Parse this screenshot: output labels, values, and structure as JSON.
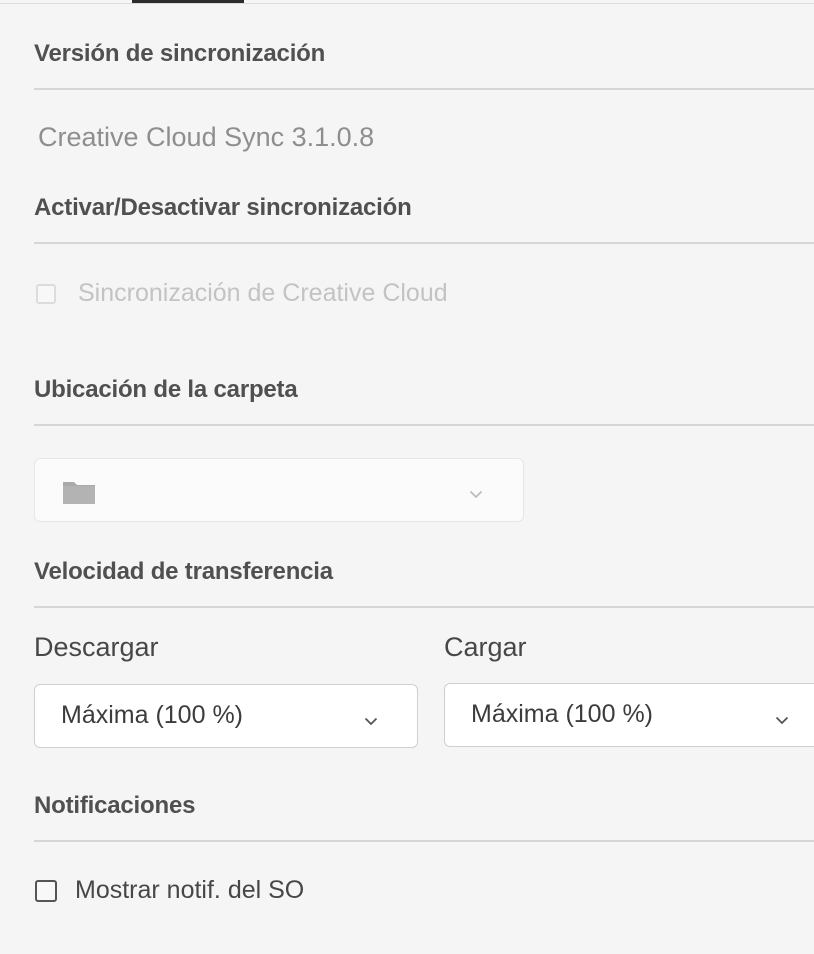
{
  "sync_version": {
    "title": "Versión de sincronización",
    "value": "Creative Cloud Sync 3.1.0.8"
  },
  "sync_toggle": {
    "title": "Activar/Desactivar sincronización",
    "checkbox_label": "Sincronización de Creative Cloud",
    "checked": false,
    "disabled": true
  },
  "folder_location": {
    "title": "Ubicación de la carpeta",
    "value": "",
    "icon": "folder-icon",
    "chevron": "chevron-down-icon"
  },
  "transfer_speed": {
    "title": "Velocidad de transferencia",
    "download": {
      "label": "Descargar",
      "value": "Máxima (100 %)"
    },
    "upload": {
      "label": "Cargar",
      "value": "Máxima (100 %)"
    }
  },
  "notifications": {
    "title": "Notificaciones",
    "checkbox_label": "Mostrar notif. del SO",
    "checked": false
  },
  "colors": {
    "background": "#f5f5f5",
    "divider": "#d6d6d6",
    "heading": "#505050",
    "disabled_text": "#c3c3c3"
  }
}
